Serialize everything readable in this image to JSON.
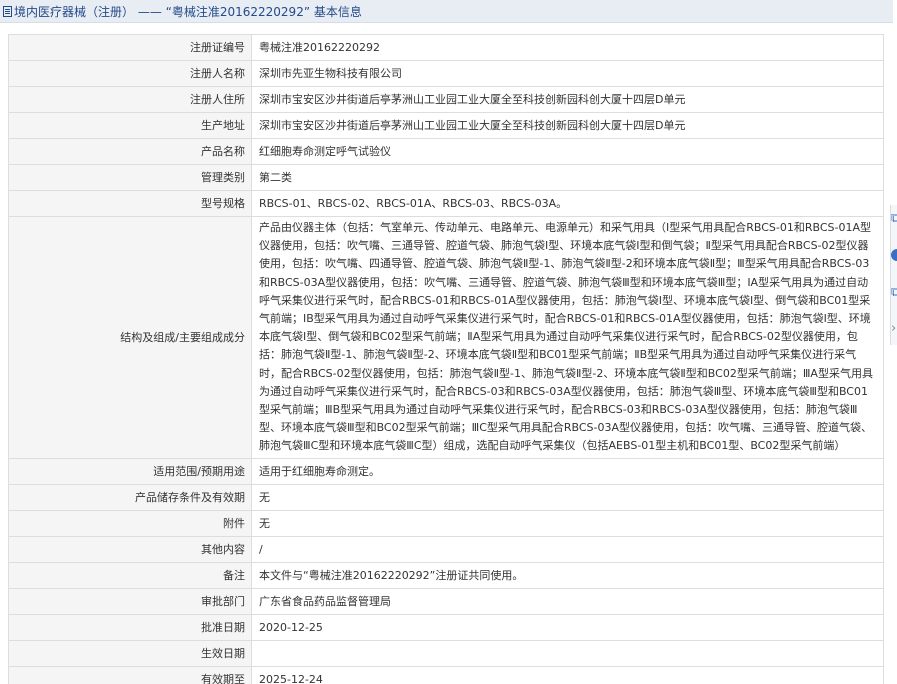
{
  "header": {
    "title": "境内医疗器械（注册） —— “粤械注准20162220292” 基本信息"
  },
  "rows": [
    {
      "label": "注册证编号",
      "value": "粤械注准20162220292"
    },
    {
      "label": "注册人名称",
      "value": "深圳市先亚生物科技有限公司"
    },
    {
      "label": "注册人住所",
      "value": "深圳市宝安区沙井街道后亭茅洲山工业园工业大厦全至科技创新园科创大厦十四层D单元"
    },
    {
      "label": "生产地址",
      "value": "深圳市宝安区沙井街道后亭茅洲山工业园工业大厦全至科技创新园科创大厦十四层D单元"
    },
    {
      "label": "产品名称",
      "value": "红细胞寿命测定呼气试验仪"
    },
    {
      "label": "管理类别",
      "value": "第二类"
    },
    {
      "label": "型号规格",
      "value": "RBCS-01、RBCS-02、RBCS-01A、RBCS-03、RBCS-03A。"
    },
    {
      "label": "结构及组成/主要组成成分",
      "value": "产品由仪器主体（包括：气室单元、传动单元、电路单元、电源单元）和采气用具（Ⅰ型采气用具配合RBCS-01和RBCS-01A型仪器使用，包括：吹气嘴、三通导管、腔道气袋、肺泡气袋Ⅰ型、环境本底气袋Ⅰ型和倒气袋；Ⅱ型采气用具配合RBCS-02型仪器使用，包括：吹气嘴、四通导管、腔道气袋、肺泡气袋Ⅱ型-1、肺泡气袋Ⅱ型-2和环境本底气袋Ⅱ型；Ⅲ型采气用具配合RBCS-03和RBCS-03A型仪器使用，包括：吹气嘴、三通导管、腔道气袋、肺泡气袋Ⅲ型和环境本底气袋Ⅲ型；ⅠA型采气用具为通过自动呼气采集仪进行采气时，配合RBCS-01和RBCS-01A型仪器使用，包括：肺泡气袋Ⅰ型、环境本底气袋Ⅰ型、倒气袋和BC01型采气前端；ⅠB型采气用具为通过自动呼气采集仪进行采气时，配合RBCS-01和RBCS-01A型仪器使用，包括：肺泡气袋Ⅰ型、环境本底气袋Ⅰ型、倒气袋和BC02型采气前端；ⅡA型采气用具为通过自动呼气采集仪进行采气时，配合RBCS-02型仪器使用，包括：肺泡气袋Ⅱ型-1、肺泡气袋Ⅱ型-2、环境本底气袋Ⅱ型和BC01型采气前端；ⅡB型采气用具为通过自动呼气采集仪进行采气时，配合RBCS-02型仪器使用，包括：肺泡气袋Ⅱ型-1、肺泡气袋Ⅱ型-2、环境本底气袋Ⅱ型和BC02型采气前端；ⅢA型采气用具为通过自动呼气采集仪进行采气时，配合RBCS-03和RBCS-03A型仪器使用，包括：肺泡气袋Ⅲ型、环境本底气袋Ⅲ型和BC01型采气前端；ⅢB型采气用具为通过自动呼气采集仪进行采气时，配合RBCS-03和RBCS-03A型仪器使用，包括：肺泡气袋Ⅲ型、环境本底气袋Ⅲ型和BC02型采气前端；ⅢC型采气用具配合RBCS-03A型仪器使用，包括：吹气嘴、三通导管、腔道气袋、肺泡气袋ⅢC型和环境本底气袋ⅢC型）组成，选配自动呼气采集仪（包括AEBS-01型主机和BC01型、BC02型采气前端）"
    },
    {
      "label": "适用范围/预期用途",
      "value": "适用于红细胞寿命测定。"
    },
    {
      "label": "产品储存条件及有效期",
      "value": "无"
    },
    {
      "label": "附件",
      "value": "无"
    },
    {
      "label": "其他内容",
      "value": "/"
    },
    {
      "label": "备注",
      "value": "本文件与“粤械注准20162220292”注册证共同使用。"
    },
    {
      "label": "审批部门",
      "value": "广东省食品药品监督管理局"
    },
    {
      "label": "批准日期",
      "value": "2020-12-25"
    },
    {
      "label": "生效日期",
      "value": ""
    },
    {
      "label": "有效期至",
      "value": "2025-12-24"
    }
  ],
  "side_tools": {
    "icons": [
      "copy-icon",
      "info-icon",
      "share-icon",
      "chevron-right-icon"
    ],
    "accent_color": "#3b6fc4"
  }
}
